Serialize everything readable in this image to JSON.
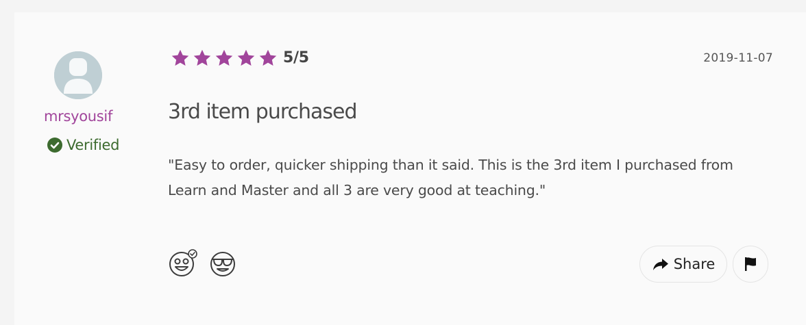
{
  "review": {
    "author": {
      "username": "mrsyousif",
      "verified_label": "Verified",
      "avatar_icon": "default-user-avatar-icon"
    },
    "rating": {
      "value": 5,
      "max": 5,
      "label": "5/5",
      "star_color": "#a1459b"
    },
    "date": "2019-11-07",
    "title": "3rd item purchased",
    "body": "\"Easy to order, quicker shipping than it said. This is the 3rd item I purchased from Learn and Master and all 3 are very good at teaching.\"",
    "reactions": [
      {
        "icon": "grinning-face-checked-icon"
      },
      {
        "icon": "cool-sunglasses-face-icon"
      }
    ],
    "actions": {
      "share_label": "Share",
      "share_icon": "share-arrow-icon",
      "flag_icon": "flag-icon"
    }
  },
  "colors": {
    "accent": "#a1459b",
    "verified": "#3d6b2f",
    "text": "#4a4a4a"
  }
}
